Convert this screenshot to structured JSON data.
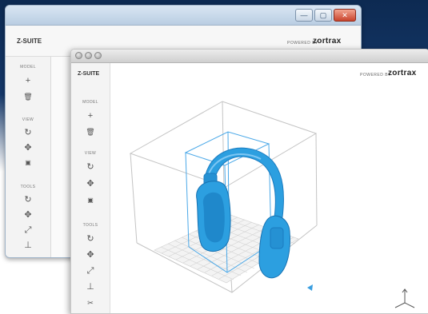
{
  "app": {
    "logo": "Z-SUITE",
    "powered_by": "POWERED BY",
    "brand": "zortrax"
  },
  "window_controls": {
    "minimize": "—",
    "maximize": "▢",
    "close": "✕"
  },
  "sidebar": {
    "model_label": "MODEL",
    "view_label": "VIEW",
    "tools_label": "TOOLS",
    "model_tools": [
      {
        "icon": "plus-icon",
        "glyph": "+"
      },
      {
        "icon": "trash-icon",
        "glyph": "🗑"
      }
    ],
    "view_tools": [
      {
        "icon": "rotate-icon",
        "glyph": "↻"
      },
      {
        "icon": "move-icon",
        "glyph": "✥"
      },
      {
        "icon": "camera-icon",
        "glyph": "▣"
      }
    ],
    "tools_tools": [
      {
        "icon": "rotate-model-icon",
        "glyph": "↻"
      },
      {
        "icon": "move-model-icon",
        "glyph": "✥"
      },
      {
        "icon": "scale-icon",
        "glyph": "⤢"
      },
      {
        "icon": "place-icon",
        "glyph": "⊥"
      },
      {
        "icon": "cut-icon",
        "glyph": "✂"
      }
    ]
  },
  "colors": {
    "model": "#2c9fe0",
    "bounding_box": "#4aa8e8",
    "grid": "#cfcfcf"
  }
}
